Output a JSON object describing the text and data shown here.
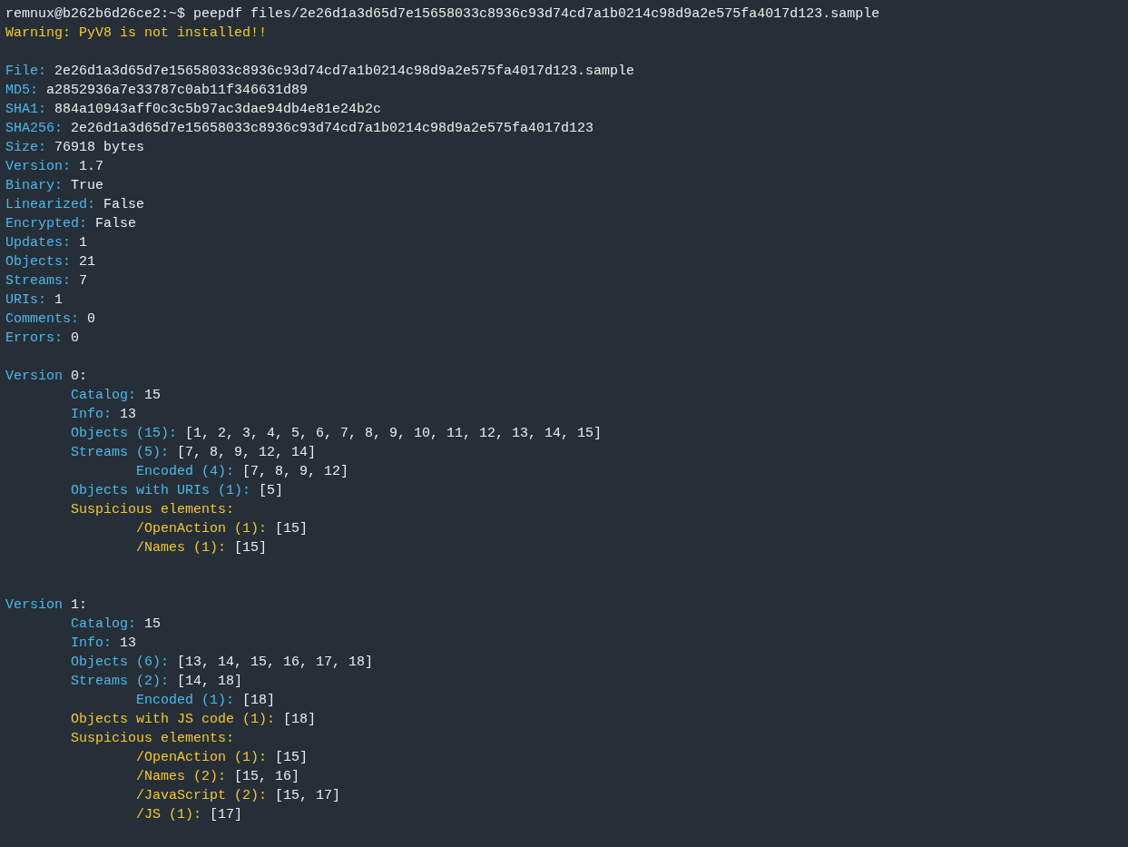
{
  "terminal": {
    "lines": [
      {
        "kind": "prompt",
        "prompt": "remnux@b262b6d26ce2:~$",
        "command": "peepdf files/2e26d1a3d65d7e15658033c8936c93d74cd7a1b0214c98d9a2e575fa4017d123.sample"
      },
      {
        "kind": "warning",
        "text": "Warning: PyV8 is not installed!!"
      },
      {
        "kind": "blank"
      },
      {
        "kind": "field",
        "key": "File:",
        "value": "2e26d1a3d65d7e15658033c8936c93d74cd7a1b0214c98d9a2e575fa4017d123.sample"
      },
      {
        "kind": "field",
        "key": "MD5:",
        "value": "a2852936a7e33787c0ab11f346631d89"
      },
      {
        "kind": "field",
        "key": "SHA1:",
        "value": "884a10943aff0c3c5b97ac3dae94db4e81e24b2c"
      },
      {
        "kind": "field",
        "key": "SHA256:",
        "value": "2e26d1a3d65d7e15658033c8936c93d74cd7a1b0214c98d9a2e575fa4017d123"
      },
      {
        "kind": "field",
        "key": "Size:",
        "value": "76918 bytes"
      },
      {
        "kind": "field",
        "key": "Version:",
        "value": "1.7"
      },
      {
        "kind": "field",
        "key": "Binary:",
        "value": "True"
      },
      {
        "kind": "field",
        "key": "Linearized:",
        "value": "False"
      },
      {
        "kind": "field",
        "key": "Encrypted:",
        "value": "False"
      },
      {
        "kind": "field",
        "key": "Updates:",
        "value": "1"
      },
      {
        "kind": "field",
        "key": "Objects:",
        "value": "21"
      },
      {
        "kind": "field",
        "key": "Streams:",
        "value": "7"
      },
      {
        "kind": "field",
        "key": "URIs:",
        "value": "1"
      },
      {
        "kind": "field",
        "key": "Comments:",
        "value": "0"
      },
      {
        "kind": "field",
        "key": "Errors:",
        "value": "0"
      },
      {
        "kind": "blank"
      },
      {
        "kind": "field",
        "key": "Version",
        "value": "0:",
        "children": [
          {
            "kind": "field",
            "key": "Catalog:",
            "value": "15"
          },
          {
            "kind": "field",
            "key": "Info:",
            "value": "13"
          },
          {
            "kind": "field",
            "key": "Objects (15):",
            "value": "[1, 2, 3, 4, 5, 6, 7, 8, 9, 10, 11, 12, 13, 14, 15]"
          },
          {
            "kind": "field",
            "key": "Streams (5):",
            "value": "[7, 8, 9, 12, 14]",
            "children": [
              {
                "kind": "field",
                "key": "Encoded (4):",
                "value": "[7, 8, 9, 12]"
              }
            ]
          },
          {
            "kind": "field",
            "key": "Objects with URIs (1):",
            "value": "[5]"
          },
          {
            "kind": "alert",
            "key": "Suspicious elements:",
            "children": [
              {
                "kind": "alert",
                "key": "/OpenAction (1):",
                "value": "[15]"
              },
              {
                "kind": "alert",
                "key": "/Names (1):",
                "value": "[15]"
              }
            ]
          }
        ]
      },
      {
        "kind": "blank"
      },
      {
        "kind": "blank"
      },
      {
        "kind": "field",
        "key": "Version",
        "value": "1:",
        "children": [
          {
            "kind": "field",
            "key": "Catalog:",
            "value": "15"
          },
          {
            "kind": "field",
            "key": "Info:",
            "value": "13"
          },
          {
            "kind": "field",
            "key": "Objects (6):",
            "value": "[13, 14, 15, 16, 17, 18]"
          },
          {
            "kind": "field",
            "key": "Streams (2):",
            "value": "[14, 18]",
            "children": [
              {
                "kind": "field",
                "key": "Encoded (1):",
                "value": "[18]"
              }
            ]
          },
          {
            "kind": "alert",
            "key": "Objects with JS code (1):",
            "value": "[18]"
          },
          {
            "kind": "alert",
            "key": "Suspicious elements:",
            "children": [
              {
                "kind": "alert",
                "key": "/OpenAction (1):",
                "value": "[15]"
              },
              {
                "kind": "alert",
                "key": "/Names (2):",
                "value": "[15, 16]"
              },
              {
                "kind": "alert",
                "key": "/JavaScript (2):",
                "value": "[15, 17]"
              },
              {
                "kind": "alert",
                "key": "/JS (1):",
                "value": "[17]"
              }
            ]
          }
        ]
      }
    ]
  }
}
